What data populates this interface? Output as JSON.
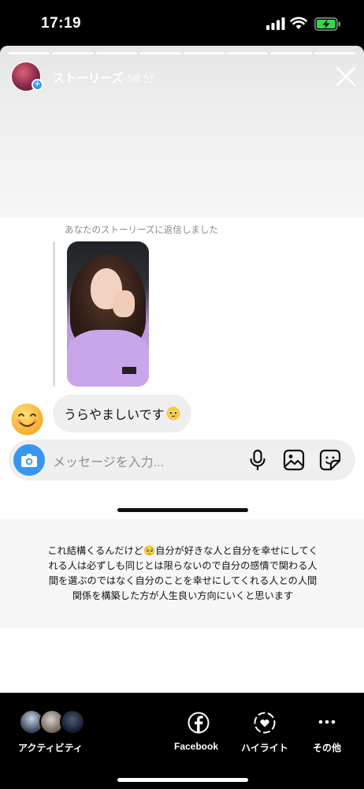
{
  "status_bar": {
    "time": "17:19",
    "signal_icon": "cellular-signal-icon",
    "wifi_icon": "wifi-icon",
    "battery_icon": "battery-charging-icon",
    "battery_color": "#32d74b"
  },
  "story_header": {
    "title": "ストーリーズ",
    "age": "58 分",
    "close_icon": "close-icon",
    "avatar_badge": "+"
  },
  "conversation": {
    "reply_note": "あなたのストーリーズに返信しました",
    "reply_message": "うらやましいです",
    "reply_emoji": "pleading-face-emoji",
    "sender_avatar": "smiling-face-emoji"
  },
  "composer": {
    "placeholder": "メッセージを入力...",
    "camera_icon": "camera-icon",
    "mic_icon": "microphone-icon",
    "gallery_icon": "image-icon",
    "sticker_icon": "sticker-icon",
    "accent_color": "#3797f0"
  },
  "caption": {
    "text": "これ結構くるんだけど🥺自分が好きな人と自分を幸せにしてくれる人は必ずしも同じとは限らないので自分の感情で関わる人間を選ぶのではなく自分のことを幸せにしてくれる人との人間関係を構築した方が人生良い方向にいくと思います"
  },
  "footer": {
    "activity_label": "アクティビティ",
    "facebook_label": "Facebook",
    "highlight_label": "ハイライト",
    "more_label": "その他"
  }
}
